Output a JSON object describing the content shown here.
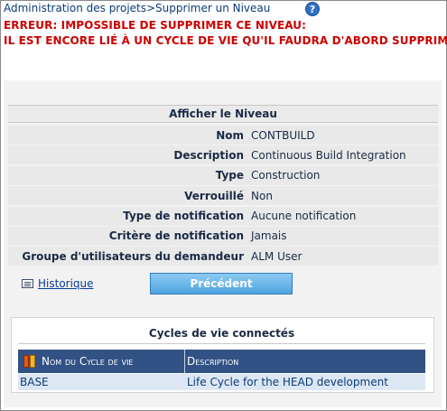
{
  "header": {
    "breadcrumb": "Administration des projets>Supprimer un Niveau",
    "help_icon": "question-icon"
  },
  "error": {
    "line1": "ERREUR: IMPOSSIBLE DE SUPPRIMER CE NIVEAU:",
    "line2": "IL EST ENCORE LIÉ À UN CYCLE DE VIE QU'IL FAUDRA D'ABORD SUPPRIMER.",
    "color": "#cc0000"
  },
  "details": {
    "title": "Afficher le Niveau",
    "rows": [
      {
        "label": "Nom",
        "value": "CONTBUILD"
      },
      {
        "label": "Description",
        "value": "Continuous Build Integration"
      },
      {
        "label": "Type",
        "value": "Construction"
      },
      {
        "label": "Verrouillé",
        "value": "Non"
      },
      {
        "label": "Type de notification",
        "value": "Aucune notification"
      },
      {
        "label": "Critère de notification",
        "value": "Jamais"
      },
      {
        "label": "Groupe d'utilisateurs du demandeur",
        "value": "ALM User"
      }
    ]
  },
  "actions": {
    "history_label": "Historique",
    "history_icon": "history-list-icon",
    "previous_label": "Précédent",
    "button_color": "#4ea4e0"
  },
  "cycles": {
    "title": "Cycles de vie connectés",
    "columns": [
      "Nom du Cycle de vie",
      "Description"
    ],
    "header_color": "#325185",
    "rows": [
      {
        "name": "BASE",
        "description": "Life Cycle for the HEAD development"
      }
    ]
  }
}
